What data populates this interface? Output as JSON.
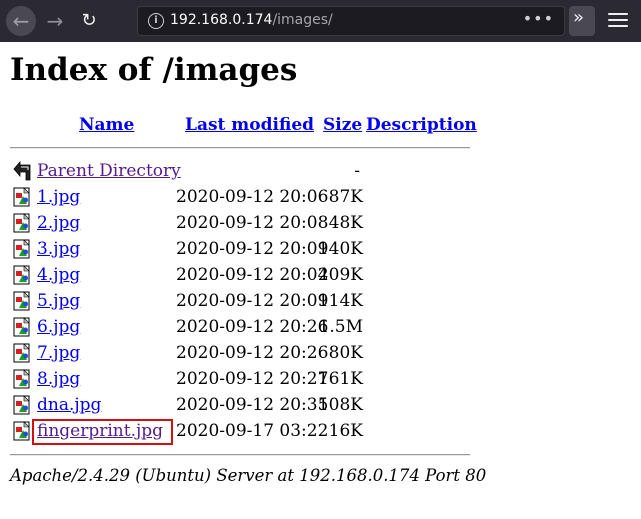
{
  "browser": {
    "url_host": "192.168.0.174",
    "url_path": "/images/",
    "back_glyph": "←",
    "forward_glyph": "→",
    "reload_glyph": "↻",
    "info_glyph": "i",
    "dots_glyph": "•••",
    "overflow_glyph": "»"
  },
  "page": {
    "title": "Index of /images",
    "columns": {
      "name": "Name",
      "modified": "Last modified",
      "size": "Size",
      "description": "Description"
    },
    "parent": {
      "name": "Parent Directory",
      "size": "-"
    },
    "files": [
      {
        "name": "1.jpg",
        "modified": "2020-09-12 20:06",
        "size": "87K"
      },
      {
        "name": "2.jpg",
        "modified": "2020-09-12 20:08",
        "size": "48K"
      },
      {
        "name": "3.jpg",
        "modified": "2020-09-12 20:09",
        "size": "140K"
      },
      {
        "name": "4.jpg",
        "modified": "2020-09-12 20:04",
        "size": "209K"
      },
      {
        "name": "5.jpg",
        "modified": "2020-09-12 20:09",
        "size": "114K"
      },
      {
        "name": "6.jpg",
        "modified": "2020-09-12 20:26",
        "size": "1.5M"
      },
      {
        "name": "7.jpg",
        "modified": "2020-09-12 20:26",
        "size": "80K"
      },
      {
        "name": "8.jpg",
        "modified": "2020-09-12 20:27",
        "size": "161K"
      },
      {
        "name": "dna.jpg",
        "modified": "2020-09-12 20:35",
        "size": "108K"
      },
      {
        "name": "fingerprint.jpg",
        "modified": "2020-09-17 03:22",
        "size": "16K"
      }
    ],
    "footer": "Apache/2.4.29 (Ubuntu) Server at 192.168.0.174 Port 80"
  },
  "colors": {
    "link": "#0000ee",
    "visited_link": "#551a8b",
    "highlight_border": "#d01010",
    "toolbar_bg": "#2b2a33"
  }
}
